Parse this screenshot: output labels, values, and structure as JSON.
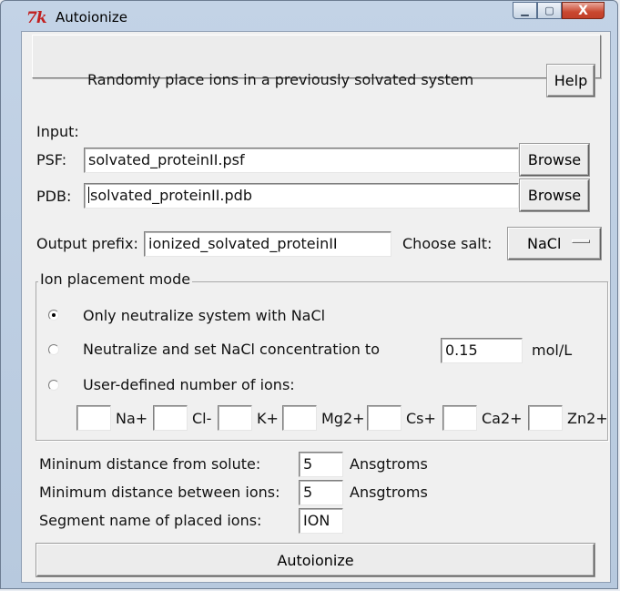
{
  "window": {
    "title": "Autoionize",
    "icon_text": "7k",
    "minimize_glyph": "▁",
    "maximize_glyph": "▢",
    "close_glyph": "X"
  },
  "header": {
    "description": "Randomly place ions in a previously solvated system",
    "help_label": "Help"
  },
  "input": {
    "section_label": "Input:",
    "psf_label": "PSF:",
    "psf_value": "solvated_proteinII.psf",
    "pdb_label": "PDB:",
    "pdb_value": "solvated_proteinII.pdb",
    "browse_label": "Browse"
  },
  "output": {
    "prefix_label": "Output prefix:",
    "prefix_value": "ionized_solvated_proteinII",
    "salt_label": "Choose salt:",
    "salt_value": "NaCl"
  },
  "placement": {
    "title": "Ion placement mode",
    "options": [
      {
        "label": "Only neutralize system with NaCl",
        "selected": true
      },
      {
        "label": "Neutralize and set NaCl concentration to",
        "selected": false
      },
      {
        "label": "User-defined number of ions:",
        "selected": false
      }
    ],
    "concentration_value": "0.15",
    "concentration_unit": "mol/L",
    "ions": [
      "Na+",
      "Cl-",
      "K+",
      "Mg2+",
      "Cs+",
      "Ca2+",
      "Zn2+"
    ]
  },
  "distances": {
    "solute_label": "Mininum distance from solute:",
    "solute_value": "5",
    "ions_label": "Minimum distance between ions:",
    "ions_value": "5",
    "unit": "Ansgtroms",
    "segment_label": "Segment name of placed ions:",
    "segment_value": "ION"
  },
  "actions": {
    "autoionize_label": "Autoionize"
  }
}
